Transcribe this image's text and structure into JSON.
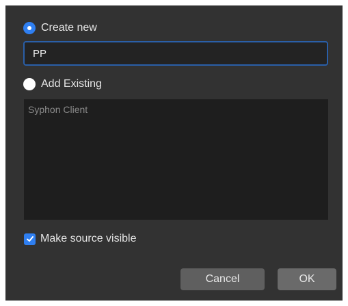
{
  "dialog": {
    "create_new": {
      "label": "Create new",
      "selected": true
    },
    "name_input": {
      "value": "PP"
    },
    "add_existing": {
      "label": "Add Existing",
      "selected": false
    },
    "existing_list": {
      "items": [
        "Syphon Client"
      ]
    },
    "make_visible": {
      "label": "Make source visible",
      "checked": true
    },
    "buttons": {
      "cancel": "Cancel",
      "ok": "OK"
    },
    "colors": {
      "accent": "#2f7ff1",
      "background": "#323232",
      "input_border": "#2a5fa8"
    }
  }
}
